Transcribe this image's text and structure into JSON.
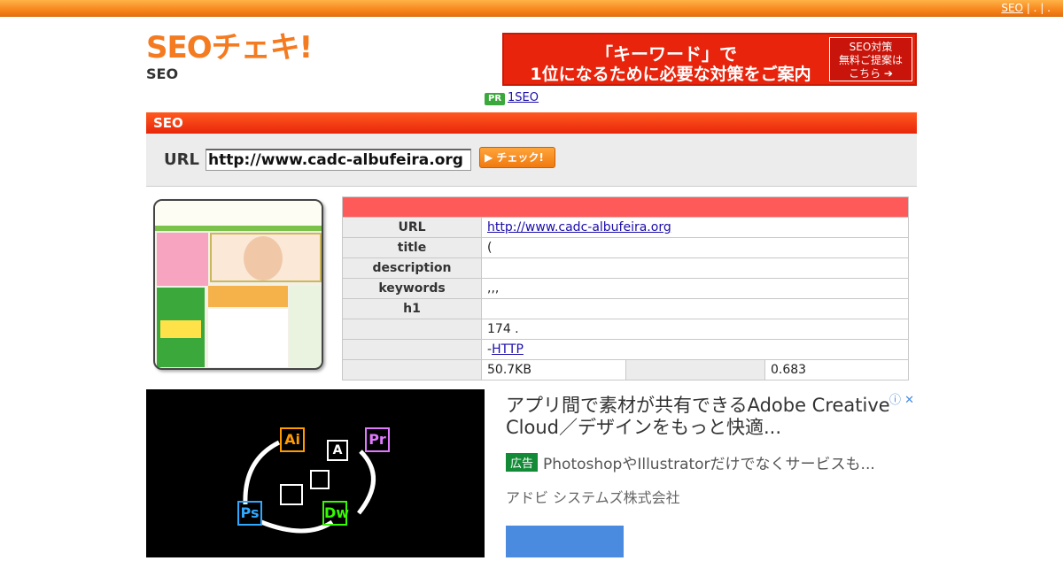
{
  "topbar": {
    "link": "SEO",
    "separators": "| . | ."
  },
  "logo": {
    "mark": "SEOチェキ!",
    "sub": "SEO"
  },
  "banner": {
    "line1": "「キーワード」で",
    "line2": "1位になるために必要な対策をご案内",
    "cta": [
      "SEO対策",
      "無料ご提案は",
      "こちら ➔"
    ]
  },
  "pr": {
    "badge": "PR",
    "link": "1SEO"
  },
  "section": {
    "title": "SEO"
  },
  "url_form": {
    "label": "URL",
    "value": "http://www.cadc-albufeira.org",
    "button": "▶ チェック!"
  },
  "info_table": {
    "rows": [
      {
        "key": "URL",
        "value": "http://www.cadc-albufeira.org",
        "link": true
      },
      {
        "key": "title",
        "value": "("
      },
      {
        "key": "description",
        "value": ""
      },
      {
        "key": "keywords",
        "value": ",,,"
      },
      {
        "key": "h1",
        "value": ""
      },
      {
        "key": "",
        "value": "174 ."
      },
      {
        "key": "",
        "value_prefix": "-",
        "value": "HTTP",
        "link": true
      }
    ],
    "last_row": {
      "key": "",
      "value": "50.7KB",
      "key2": "",
      "value2": "0.683"
    }
  },
  "ad": {
    "title": "アプリ間で素材が共有できるAdobe Creative Cloud／デザインをもっと快適...",
    "tag": "広告",
    "description": "PhotoshopやIllustratorだけでなくサービスも...",
    "advertiser": "アドビ システムズ株式会社",
    "icons": "ⓘ ✕",
    "apps": [
      "Ai",
      "Pr",
      "Ps",
      "Dw",
      "A"
    ]
  }
}
